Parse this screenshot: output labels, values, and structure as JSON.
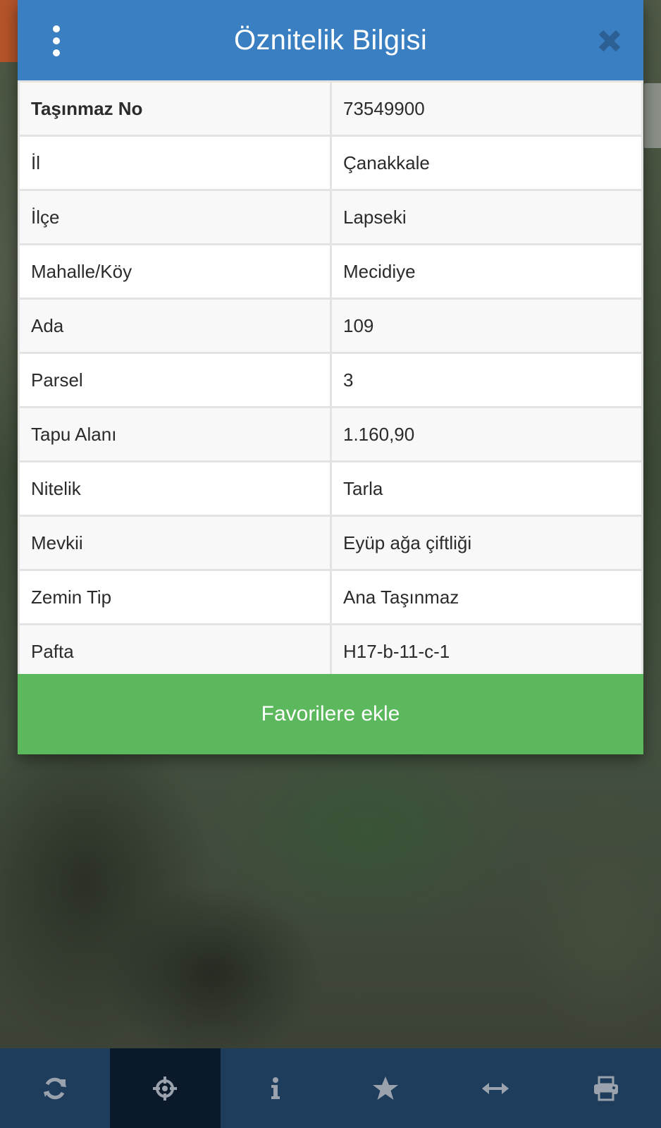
{
  "dialog": {
    "title": "Öznitelik Bilgisi",
    "menu_icon": "vertical-dots-icon",
    "close_icon": "close-icon",
    "rows": [
      {
        "label": "Taşınmaz No",
        "value": "73549900"
      },
      {
        "label": "İl",
        "value": "Çanakkale"
      },
      {
        "label": "İlçe",
        "value": "Lapseki"
      },
      {
        "label": "Mahalle/Köy",
        "value": "Mecidiye"
      },
      {
        "label": "Ada",
        "value": "109"
      },
      {
        "label": "Parsel",
        "value": "3"
      },
      {
        "label": "Tapu Alanı",
        "value": "1.160,90"
      },
      {
        "label": "Nitelik",
        "value": "Tarla"
      },
      {
        "label": "Mevkii",
        "value": "Eyüp ağa çiftliği"
      },
      {
        "label": "Zemin Tip",
        "value": "Ana Taşınmaz"
      },
      {
        "label": "Pafta",
        "value": "H17-b-11-c-1"
      }
    ],
    "favorite_button_label": "Favorilere ekle"
  },
  "toolbar": {
    "items": [
      {
        "icon": "refresh-icon",
        "active": false
      },
      {
        "icon": "crosshair-icon",
        "active": true
      },
      {
        "icon": "info-icon",
        "active": false
      },
      {
        "icon": "star-icon",
        "active": false
      },
      {
        "icon": "measure-arrows-icon",
        "active": false
      },
      {
        "icon": "print-icon",
        "active": false
      }
    ]
  },
  "colors": {
    "header": "#3a7fc1",
    "favorite_button": "#5cb85c",
    "toolbar": "#1e3d5c",
    "toolbar_active": "#0a1a2a",
    "icon": "#9aa3ad"
  }
}
